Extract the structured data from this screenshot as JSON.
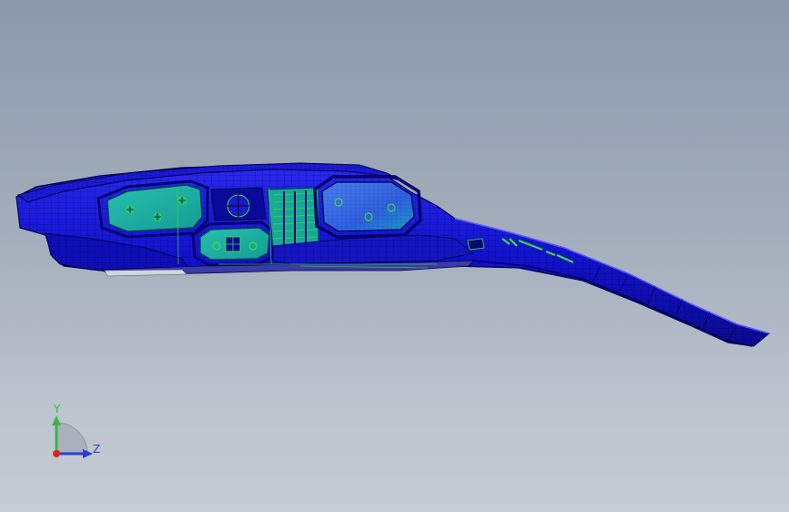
{
  "viewport": {
    "background_top": "#8d98a9",
    "background_bottom": "#c6ccd4"
  },
  "model": {
    "name": "",
    "body_color": "#1010d8",
    "dark_color": "#05056e",
    "panel_color": "#19b5a8",
    "accent_color": "#3ddc3d",
    "mesh_color": "#000000"
  },
  "triad": {
    "y_label": "Y",
    "z_label": "Z",
    "y_color": "#3fb24a",
    "z_color": "#2c3fd6",
    "origin_color": "#e02020"
  }
}
